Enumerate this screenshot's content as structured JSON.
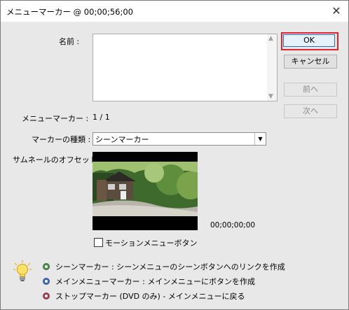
{
  "window": {
    "title": "メニューマーカー @ 00;00;56;00"
  },
  "labels": {
    "name": "名前 :",
    "menu_marker": "メニューマーカー :",
    "menu_marker_count": "1 / 1",
    "marker_type": "マーカーの種類 :",
    "thumb_offset": "サムネールのオフセット :",
    "timecode": "00;00;00;00",
    "motion_menu_button": "モーションメニューボタン"
  },
  "name_field": {
    "value": ""
  },
  "buttons": {
    "ok": "OK",
    "cancel": "キャンセル",
    "prev": "前へ",
    "next": "次へ"
  },
  "marker_type": {
    "selected": "シーンマーカー"
  },
  "motion_menu_checked": false,
  "legend": [
    {
      "text": "シーンマーカー : シーンメニューのシーンボタンへのリンクを作成",
      "color": "#3c9c3a",
      "icon": "scene-marker-icon"
    },
    {
      "text": "メインメニューマーカー : メインメニューにボタンを作成",
      "color": "#2b6cd6",
      "icon": "main-menu-marker-icon"
    },
    {
      "text": "ストップマーカー (DVD のみ) - メインメニューに戻る",
      "color": "#c0314a",
      "icon": "stop-marker-icon"
    }
  ],
  "colors": {
    "highlight": "#e0242d",
    "accent": "#2b6cc4"
  }
}
